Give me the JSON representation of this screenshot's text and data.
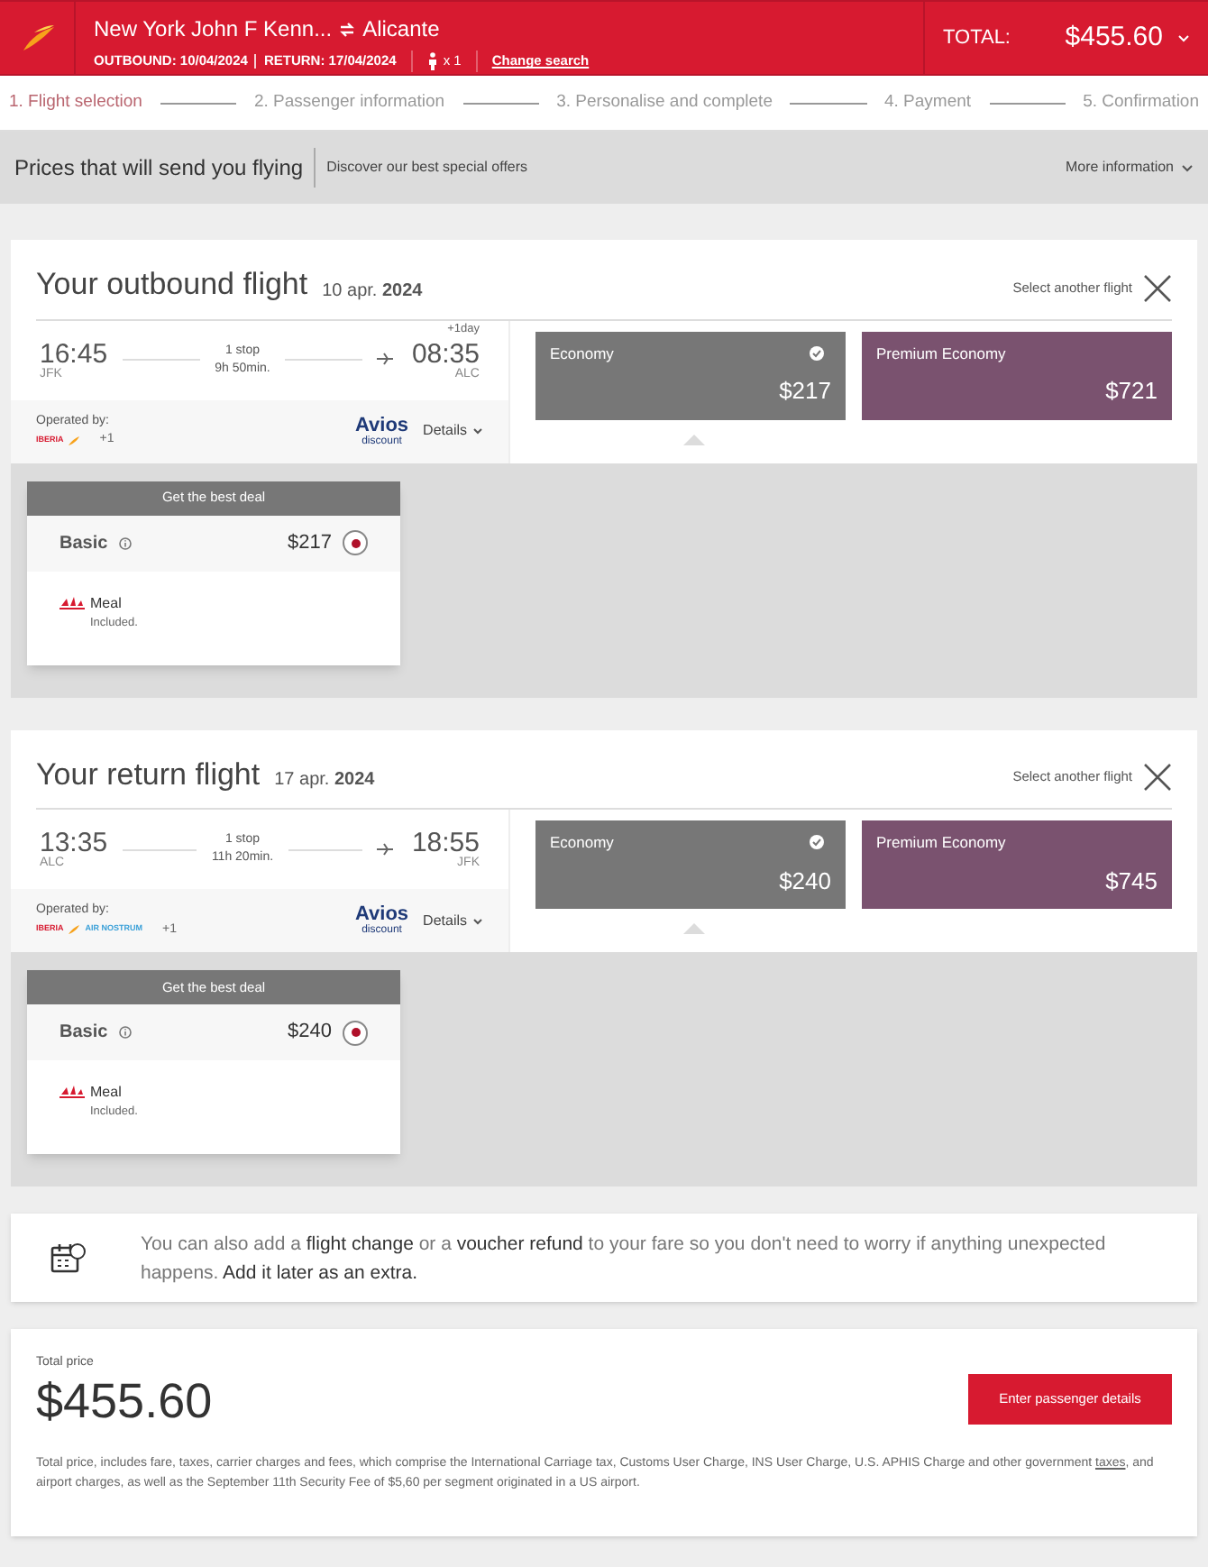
{
  "header": {
    "route_from": "New York John F Kenn...",
    "route_to": "Alicante",
    "outbound": "OUTBOUND: 10/04/2024",
    "return": "RETURN: 17/04/2024",
    "passengers": "x 1",
    "change_search": "Change search",
    "total_label": "TOTAL:",
    "total": "$455.60"
  },
  "steps": [
    {
      "label": "1. Flight selection",
      "selected": true
    },
    {
      "label": "2. Passenger information",
      "selected": false
    },
    {
      "label": "3. Personalise and complete",
      "selected": false
    },
    {
      "label": "4. Payment",
      "selected": false
    },
    {
      "label": "5. Confirmation",
      "selected": false
    }
  ],
  "promo": {
    "title": "Prices that will send you flying",
    "subtitle": "Discover our best special offers",
    "more": "More information"
  },
  "flights": [
    {
      "title": "Your outbound flight",
      "date": "10 apr. **2024**",
      "select_another": "Select another flight",
      "depart_time": "16:45",
      "depart_code": "JFK",
      "stops": "1 stop",
      "duration": "9h 50min.",
      "arrive_time": "08:35",
      "arrive_code": "ALC",
      "day_offset": "+1day",
      "operated_by": "Operated by:",
      "operators": [
        "IBERIA"
      ],
      "more_operators": "+1",
      "avios": "Avios",
      "avios_sub": "discount",
      "details": "Details",
      "fares": [
        {
          "name": "Economy",
          "price": "$217",
          "selected": true,
          "color": "#777777"
        },
        {
          "name": "Premium Economy",
          "price": "$721",
          "selected": false,
          "color": "#7a526f"
        }
      ],
      "deal": {
        "banner": "Get the best deal",
        "name": "Basic",
        "price": "$217",
        "selected": true,
        "feature": "Meal",
        "feature_note": "Included."
      }
    },
    {
      "title": "Your return flight",
      "date": "17 apr. **2024**",
      "select_another": "Select another flight",
      "depart_time": "13:35",
      "depart_code": "ALC",
      "stops": "1 stop",
      "duration": "11h 20min.",
      "arrive_time": "18:55",
      "arrive_code": "JFK",
      "operated_by": "Operated by:",
      "operators": [
        "IBERIA",
        "AIR NOSTRUM"
      ],
      "more_operators": "+1",
      "avios": "Avios",
      "avios_sub": "discount",
      "details": "Details",
      "fares": [
        {
          "name": "Economy",
          "price": "$240",
          "selected": true,
          "color": "#777777"
        },
        {
          "name": "Premium Economy",
          "price": "$745",
          "selected": false,
          "color": "#7a526f"
        }
      ],
      "deal": {
        "banner": "Get the best deal",
        "name": "Basic",
        "price": "$240",
        "selected": true,
        "feature": "Meal",
        "feature_note": "Included."
      }
    }
  ],
  "info": "You can also add a **flight change** or a **voucher refund** to your fare so you don't need to worry if anything unexpected happens. **Add it later as an extra.**",
  "summary": {
    "label": "Total price",
    "total": "$455.60",
    "button": "Enter passenger details",
    "note_before": "Total price, includes fare, taxes, carrier charges and fees, which comprise the International Carriage tax, Customs User Charge, INS User Charge, U.S. APHIS Charge and other government",
    "note_link": "taxes",
    "note_after": ", and airport charges, as well as the September 11th Security Fee of $5,60 per segment originated in a US airport."
  }
}
